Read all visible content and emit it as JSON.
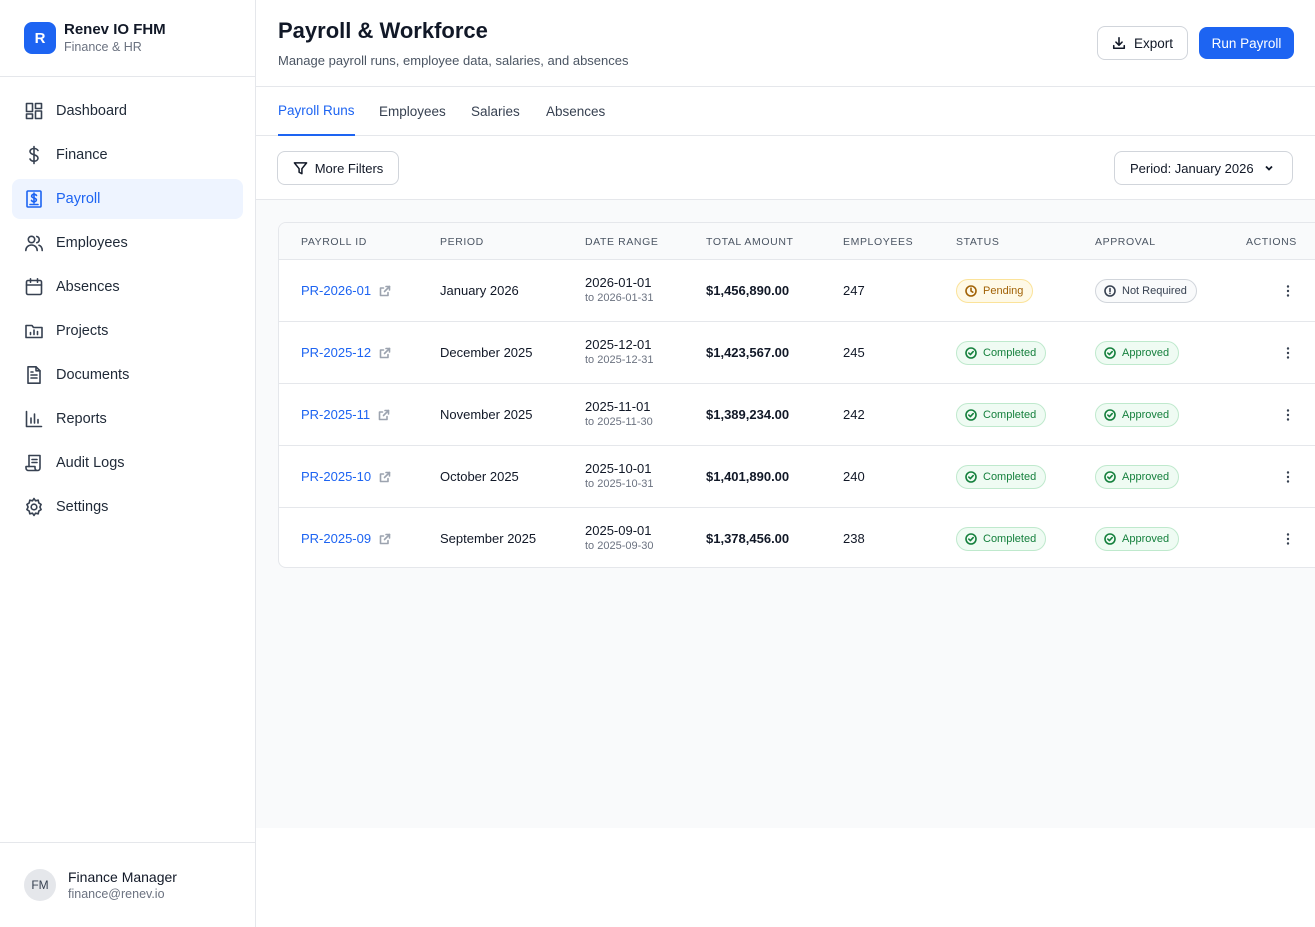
{
  "brand": {
    "logo_letter": "R",
    "name": "Renev IO FHM",
    "subtitle": "Finance & HR",
    "accent": "#1d64f2"
  },
  "sidebar": {
    "items": [
      {
        "label": "Dashboard",
        "icon": "dashboard-icon"
      },
      {
        "label": "Finance",
        "icon": "dollar-icon"
      },
      {
        "label": "Payroll",
        "icon": "payroll-icon",
        "active": true
      },
      {
        "label": "Employees",
        "icon": "users-icon"
      },
      {
        "label": "Absences",
        "icon": "calendar-icon"
      },
      {
        "label": "Projects",
        "icon": "folder-chart-icon"
      },
      {
        "label": "Documents",
        "icon": "document-icon"
      },
      {
        "label": "Reports",
        "icon": "bar-chart-icon"
      },
      {
        "label": "Audit Logs",
        "icon": "scroll-icon"
      },
      {
        "label": "Settings",
        "icon": "gear-icon"
      }
    ]
  },
  "user": {
    "initials": "FM",
    "name": "Finance Manager",
    "email": "finance@renev.io"
  },
  "header": {
    "title": "Payroll & Workforce",
    "subtitle": "Manage payroll runs, employee data, salaries, and absences",
    "export_label": "Export",
    "run_label": "Run Payroll"
  },
  "tabs": [
    {
      "label": "Payroll Runs",
      "active": true
    },
    {
      "label": "Employees"
    },
    {
      "label": "Salaries"
    },
    {
      "label": "Absences"
    }
  ],
  "filters": {
    "more_label": "More Filters",
    "period_label": "Period: January 2026"
  },
  "table": {
    "columns": [
      "Payroll ID",
      "Period",
      "Date Range",
      "Total Amount",
      "Employees",
      "Status",
      "Approval",
      "Actions"
    ],
    "rows": [
      {
        "id": "PR-2026-01",
        "period": "January 2026",
        "from": "2026-01-01",
        "to": "to 2026-01-31",
        "amount": "$1,456,890.00",
        "employees": "247",
        "status": "Pending",
        "approval": "Not Required"
      },
      {
        "id": "PR-2025-12",
        "period": "December 2025",
        "from": "2025-12-01",
        "to": "to 2025-12-31",
        "amount": "$1,423,567.00",
        "employees": "245",
        "status": "Completed",
        "approval": "Approved"
      },
      {
        "id": "PR-2025-11",
        "period": "November 2025",
        "from": "2025-11-01",
        "to": "to 2025-11-30",
        "amount": "$1,389,234.00",
        "employees": "242",
        "status": "Completed",
        "approval": "Approved"
      },
      {
        "id": "PR-2025-10",
        "period": "October 2025",
        "from": "2025-10-01",
        "to": "to 2025-10-31",
        "amount": "$1,401,890.00",
        "employees": "240",
        "status": "Completed",
        "approval": "Approved"
      },
      {
        "id": "PR-2025-09",
        "period": "September 2025",
        "from": "2025-09-01",
        "to": "to 2025-09-30",
        "amount": "$1,378,456.00",
        "employees": "238",
        "status": "Completed",
        "approval": "Approved"
      }
    ]
  },
  "colors": {
    "pending": "#a16207",
    "completed": "#15803d",
    "not_required": "#374151"
  }
}
